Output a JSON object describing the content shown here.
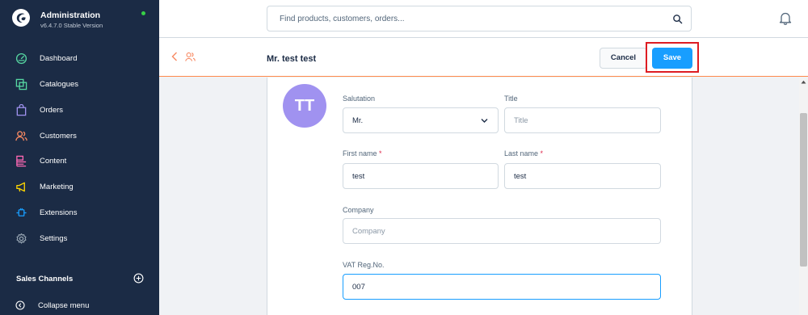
{
  "brand": {
    "title": "Administration",
    "version": "v6.4.7.0 Stable Version"
  },
  "nav": [
    {
      "label": "Dashboard",
      "icon": "dashboard-icon",
      "color": "#57d9a3"
    },
    {
      "label": "Catalogues",
      "icon": "catalogue-icon",
      "color": "#57d9a3"
    },
    {
      "label": "Orders",
      "icon": "orders-icon",
      "color": "#a092f0"
    },
    {
      "label": "Customers",
      "icon": "customers-icon",
      "color": "#f88962"
    },
    {
      "label": "Content",
      "icon": "content-icon",
      "color": "#ff68b4"
    },
    {
      "label": "Marketing",
      "icon": "marketing-icon",
      "color": "#ffd700"
    },
    {
      "label": "Extensions",
      "icon": "extensions-icon",
      "color": "#189eff"
    },
    {
      "label": "Settings",
      "icon": "settings-icon",
      "color": "#9aa8b5"
    }
  ],
  "sales_channels": {
    "title": "Sales Channels"
  },
  "collapse_menu": "Collapse menu",
  "search": {
    "placeholder": "Find products, customers, orders..."
  },
  "smartbar": {
    "title": "Mr. test test",
    "cancel_label": "Cancel",
    "save_label": "Save"
  },
  "avatar": {
    "initials": "TT"
  },
  "form": {
    "salutation": {
      "label": "Salutation",
      "value": "Mr."
    },
    "title": {
      "label": "Title",
      "placeholder": "Title"
    },
    "first_name": {
      "label": "First name",
      "required": "*",
      "value": "test"
    },
    "last_name": {
      "label": "Last name",
      "required": "*",
      "value": "test"
    },
    "company": {
      "label": "Company",
      "placeholder": "Company"
    },
    "vat": {
      "label": "VAT Reg.No.",
      "value": "007"
    }
  },
  "colors": {
    "sidebar": "#1b2b45",
    "accent": "#189eff",
    "highlight": "#de1c22",
    "avatar": "#a092f0"
  }
}
